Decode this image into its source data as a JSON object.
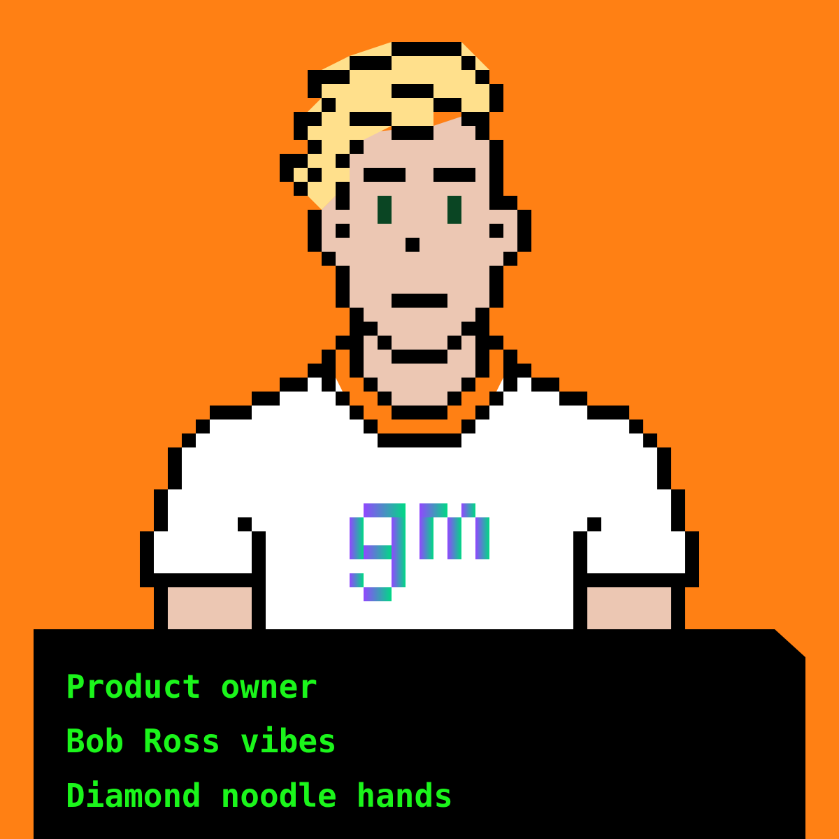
{
  "colors": {
    "background": "#ff8014",
    "outline": "#000000",
    "hair": "#ffe08c",
    "skin": "#ecc7b3",
    "eyes": "#0a4523",
    "shirt": "#ffffff",
    "caption_bg": "#000000",
    "caption_text": "#1bf51b",
    "logo_start": "#9147ff",
    "logo_end": "#00d985"
  },
  "caption": {
    "lines": [
      "Product owner",
      "Bob Ross vibes",
      "Diamond noodle hands"
    ]
  }
}
